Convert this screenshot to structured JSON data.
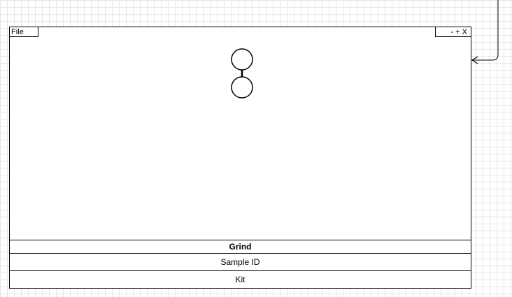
{
  "window": {
    "menu_label": "File",
    "controls_label": "- + X"
  },
  "rows": [
    {
      "label": "Grind"
    },
    {
      "label": "Sample ID"
    },
    {
      "label": "Kit"
    }
  ],
  "logo_icon": "pause-chain-icon",
  "colors": {
    "stroke": "#000000",
    "grid": "#e6e6e6",
    "background": "#ffffff"
  }
}
